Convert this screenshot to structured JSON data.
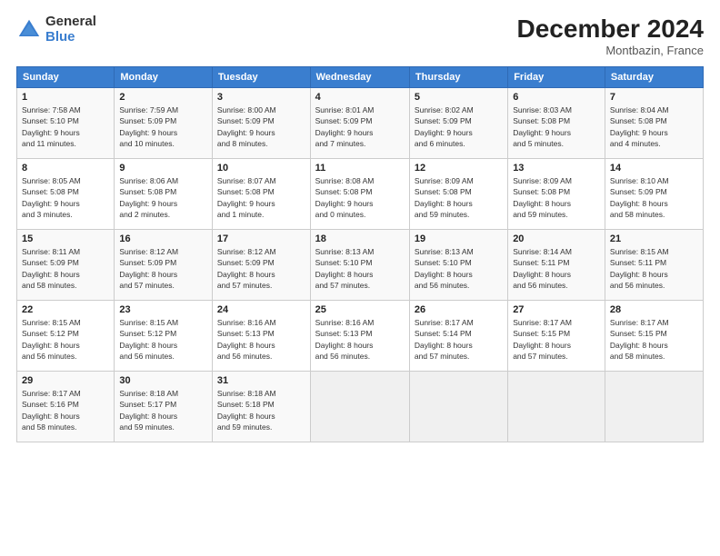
{
  "logo": {
    "general": "General",
    "blue": "Blue"
  },
  "title": "December 2024",
  "location": "Montbazin, France",
  "days_of_week": [
    "Sunday",
    "Monday",
    "Tuesday",
    "Wednesday",
    "Thursday",
    "Friday",
    "Saturday"
  ],
  "weeks": [
    [
      {
        "day": "1",
        "info": "Sunrise: 7:58 AM\nSunset: 5:10 PM\nDaylight: 9 hours\nand 11 minutes."
      },
      {
        "day": "2",
        "info": "Sunrise: 7:59 AM\nSunset: 5:09 PM\nDaylight: 9 hours\nand 10 minutes."
      },
      {
        "day": "3",
        "info": "Sunrise: 8:00 AM\nSunset: 5:09 PM\nDaylight: 9 hours\nand 8 minutes."
      },
      {
        "day": "4",
        "info": "Sunrise: 8:01 AM\nSunset: 5:09 PM\nDaylight: 9 hours\nand 7 minutes."
      },
      {
        "day": "5",
        "info": "Sunrise: 8:02 AM\nSunset: 5:09 PM\nDaylight: 9 hours\nand 6 minutes."
      },
      {
        "day": "6",
        "info": "Sunrise: 8:03 AM\nSunset: 5:08 PM\nDaylight: 9 hours\nand 5 minutes."
      },
      {
        "day": "7",
        "info": "Sunrise: 8:04 AM\nSunset: 5:08 PM\nDaylight: 9 hours\nand 4 minutes."
      }
    ],
    [
      {
        "day": "8",
        "info": "Sunrise: 8:05 AM\nSunset: 5:08 PM\nDaylight: 9 hours\nand 3 minutes."
      },
      {
        "day": "9",
        "info": "Sunrise: 8:06 AM\nSunset: 5:08 PM\nDaylight: 9 hours\nand 2 minutes."
      },
      {
        "day": "10",
        "info": "Sunrise: 8:07 AM\nSunset: 5:08 PM\nDaylight: 9 hours\nand 1 minute."
      },
      {
        "day": "11",
        "info": "Sunrise: 8:08 AM\nSunset: 5:08 PM\nDaylight: 9 hours\nand 0 minutes."
      },
      {
        "day": "12",
        "info": "Sunrise: 8:09 AM\nSunset: 5:08 PM\nDaylight: 8 hours\nand 59 minutes."
      },
      {
        "day": "13",
        "info": "Sunrise: 8:09 AM\nSunset: 5:08 PM\nDaylight: 8 hours\nand 59 minutes."
      },
      {
        "day": "14",
        "info": "Sunrise: 8:10 AM\nSunset: 5:09 PM\nDaylight: 8 hours\nand 58 minutes."
      }
    ],
    [
      {
        "day": "15",
        "info": "Sunrise: 8:11 AM\nSunset: 5:09 PM\nDaylight: 8 hours\nand 58 minutes."
      },
      {
        "day": "16",
        "info": "Sunrise: 8:12 AM\nSunset: 5:09 PM\nDaylight: 8 hours\nand 57 minutes."
      },
      {
        "day": "17",
        "info": "Sunrise: 8:12 AM\nSunset: 5:09 PM\nDaylight: 8 hours\nand 57 minutes."
      },
      {
        "day": "18",
        "info": "Sunrise: 8:13 AM\nSunset: 5:10 PM\nDaylight: 8 hours\nand 57 minutes."
      },
      {
        "day": "19",
        "info": "Sunrise: 8:13 AM\nSunset: 5:10 PM\nDaylight: 8 hours\nand 56 minutes."
      },
      {
        "day": "20",
        "info": "Sunrise: 8:14 AM\nSunset: 5:11 PM\nDaylight: 8 hours\nand 56 minutes."
      },
      {
        "day": "21",
        "info": "Sunrise: 8:15 AM\nSunset: 5:11 PM\nDaylight: 8 hours\nand 56 minutes."
      }
    ],
    [
      {
        "day": "22",
        "info": "Sunrise: 8:15 AM\nSunset: 5:12 PM\nDaylight: 8 hours\nand 56 minutes."
      },
      {
        "day": "23",
        "info": "Sunrise: 8:15 AM\nSunset: 5:12 PM\nDaylight: 8 hours\nand 56 minutes."
      },
      {
        "day": "24",
        "info": "Sunrise: 8:16 AM\nSunset: 5:13 PM\nDaylight: 8 hours\nand 56 minutes."
      },
      {
        "day": "25",
        "info": "Sunrise: 8:16 AM\nSunset: 5:13 PM\nDaylight: 8 hours\nand 56 minutes."
      },
      {
        "day": "26",
        "info": "Sunrise: 8:17 AM\nSunset: 5:14 PM\nDaylight: 8 hours\nand 57 minutes."
      },
      {
        "day": "27",
        "info": "Sunrise: 8:17 AM\nSunset: 5:15 PM\nDaylight: 8 hours\nand 57 minutes."
      },
      {
        "day": "28",
        "info": "Sunrise: 8:17 AM\nSunset: 5:15 PM\nDaylight: 8 hours\nand 58 minutes."
      }
    ],
    [
      {
        "day": "29",
        "info": "Sunrise: 8:17 AM\nSunset: 5:16 PM\nDaylight: 8 hours\nand 58 minutes."
      },
      {
        "day": "30",
        "info": "Sunrise: 8:18 AM\nSunset: 5:17 PM\nDaylight: 8 hours\nand 59 minutes."
      },
      {
        "day": "31",
        "info": "Sunrise: 8:18 AM\nSunset: 5:18 PM\nDaylight: 8 hours\nand 59 minutes."
      },
      null,
      null,
      null,
      null
    ]
  ]
}
